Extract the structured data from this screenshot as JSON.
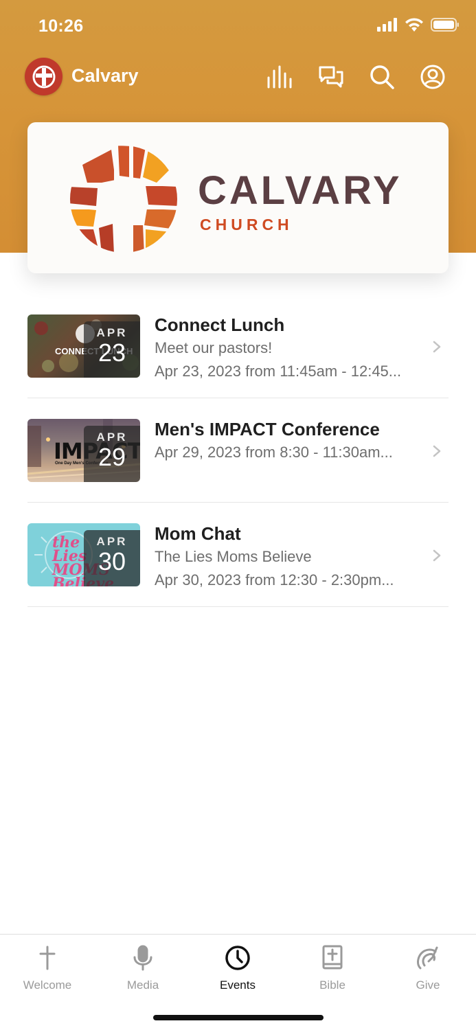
{
  "status_bar": {
    "time": "10:26"
  },
  "app_bar": {
    "brand_name": "Calvary",
    "icons": [
      "equalizer-icon",
      "chat-icon",
      "search-icon",
      "profile-icon"
    ]
  },
  "hero": {
    "title": "CALVARY",
    "subtitle": "CHURCH"
  },
  "events": [
    {
      "title": "Connect Lunch",
      "subtitle": "Meet our pastors!",
      "date_text": "Apr 23, 2023 from 11:45am - 12:45...",
      "thumb_month": "APR",
      "thumb_day": "23",
      "thumb_overlay_text": "CONNECT LUNCH"
    },
    {
      "title": "Men's IMPACT Conference",
      "subtitle": "",
      "date_text": "Apr 29, 2023 from 8:30 - 11:30am...",
      "thumb_month": "APR",
      "thumb_day": "29",
      "thumb_overlay_text": "IMPACT",
      "thumb_overlay_small": "One Day Men's Conference"
    },
    {
      "title": "Mom Chat",
      "subtitle": "The Lies Moms Believe",
      "date_text": "Apr 30, 2023 from 12:30 - 2:30pm...",
      "thumb_month": "APR",
      "thumb_day": "30",
      "thumb_overlay_text": "the Lies MOMS Believe"
    }
  ],
  "tabs": [
    {
      "label": "Welcome",
      "icon": "cross-icon",
      "active": false
    },
    {
      "label": "Media",
      "icon": "microphone-icon",
      "active": false
    },
    {
      "label": "Events",
      "icon": "clock-icon",
      "active": true
    },
    {
      "label": "Bible",
      "icon": "bible-icon",
      "active": false
    },
    {
      "label": "Give",
      "icon": "give-icon",
      "active": false
    }
  ],
  "colors": {
    "header_orange": "#d69539",
    "brand_red": "#c0392b",
    "logo_dark": "#5b3f43",
    "logo_orange": "#cf4b22"
  }
}
